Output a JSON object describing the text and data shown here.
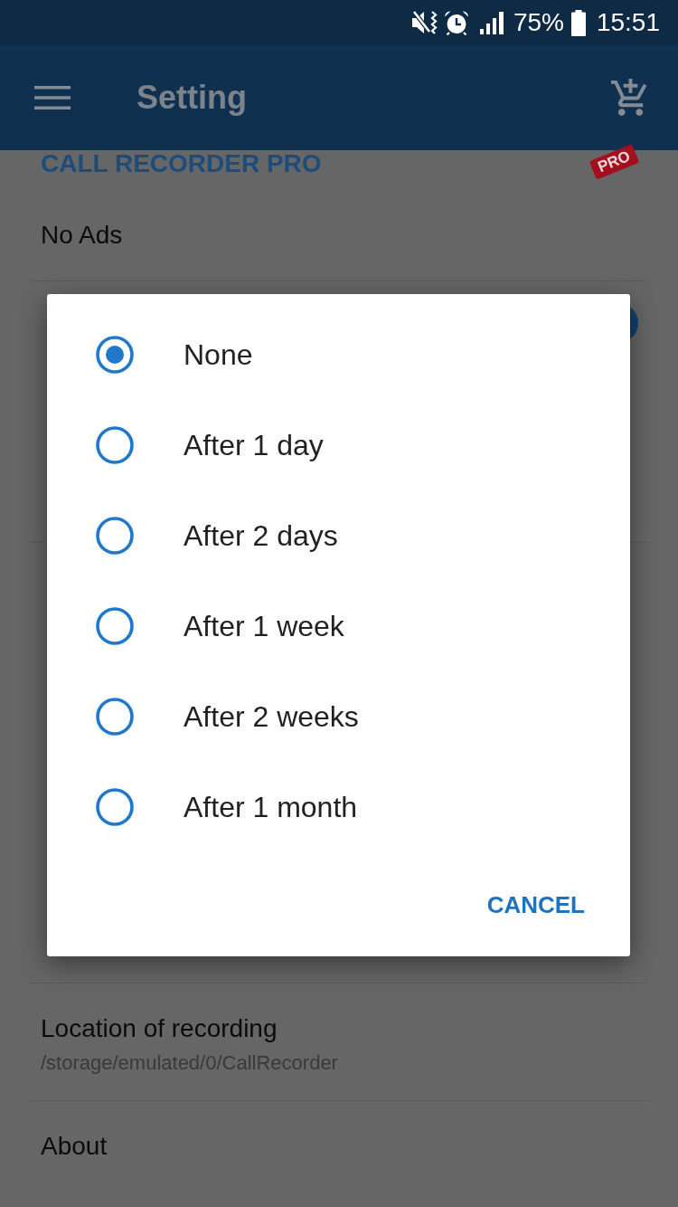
{
  "status_bar": {
    "battery": "75%",
    "time": "15:51"
  },
  "app_bar": {
    "title": "Setting"
  },
  "settings": [
    {
      "kind": "section",
      "title": "CALL RECORDER PRO",
      "badge": "PRO"
    },
    {
      "kind": "item",
      "title": "No Ads"
    },
    {
      "kind": "covered",
      "control": {
        "kind": "switch",
        "on": true
      }
    },
    {
      "kind": "item",
      "title": "Location of recording",
      "subtitle": "/storage/emulated/0/CallRecorder"
    },
    {
      "kind": "item",
      "title": "About"
    }
  ],
  "dialog": {
    "options": [
      {
        "label": "None",
        "selected": true
      },
      {
        "label": "After 1 day",
        "selected": false
      },
      {
        "label": "After 2 days",
        "selected": false
      },
      {
        "label": "After 1 week",
        "selected": false
      },
      {
        "label": "After 2 weeks",
        "selected": false
      },
      {
        "label": "After 1 month",
        "selected": false
      }
    ],
    "actions": [
      "CANCEL"
    ]
  }
}
